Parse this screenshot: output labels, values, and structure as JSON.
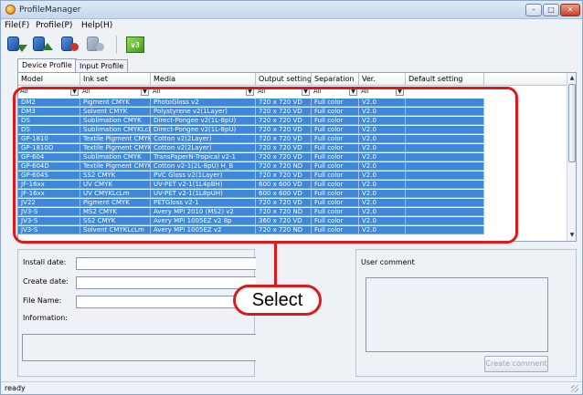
{
  "window": {
    "title": "ProfileManager"
  },
  "menu": [
    "File(F)",
    "Profile(P)",
    "Help(H)"
  ],
  "toolbar": [
    {
      "icon": "import-profile-icon"
    },
    {
      "icon": "export-profile-icon"
    },
    {
      "icon": "install-profile-icon"
    },
    {
      "icon": "delete-profile-icon"
    },
    {
      "icon": "v3-icon",
      "text": "v3"
    }
  ],
  "tabs": [
    "Device Profile",
    "Input Profile"
  ],
  "table": {
    "columns": [
      "Model",
      "Ink set",
      "Media",
      "Output setting",
      "Separation",
      "Ver.",
      "Default setting"
    ],
    "filter_value": "All",
    "rows": [
      [
        "DM2",
        "Pigment CMYK",
        "PhotoGloss v2",
        "720 x 720 VD",
        "Full color",
        "V2.0"
      ],
      [
        "DM3",
        "Solvent CMYK",
        "Polystyrene v2(1Layer)",
        "720 x 720 VD",
        "Full color",
        "V2.0"
      ],
      [
        "DS",
        "Sublimation CMYK",
        "Direct-Pongee v2(1L-8pU)",
        "720 x 720 VD",
        "Full color",
        "V2.0"
      ],
      [
        "DS",
        "Sublimation CMYKLcL...",
        "Direct-Pongee v2(1L-8pU)",
        "720 x 720 VD",
        "Full color",
        "V2.0"
      ],
      [
        "GP-1810",
        "Textile Pigment CMYK",
        "Cotton v2(2Layer)",
        "720 x 720 VD",
        "Full color",
        "V2.0"
      ],
      [
        "GP-1810D",
        "Textile Pigment CMYK",
        "Cotton v2(2Layer)",
        "720 x 720 VD",
        "Full color",
        "V2.0"
      ],
      [
        "GP-604",
        "Sublimation CMYK",
        "TransPaperN-Tropical v2-1",
        "720 x 720 VD",
        "Full color",
        "V2.0"
      ],
      [
        "GP-604D",
        "Textile Pigment CMYK",
        "Cotton v2-1(2L-8pU) H_B",
        "720 x 720 ND",
        "Full color",
        "V2.0"
      ],
      [
        "GP-604S",
        "SS2 CMYK",
        "PVC Gloss v2(1Layer)",
        "720 x 720 VD",
        "Full color",
        "V2.0"
      ],
      [
        "JF-16xx",
        "UV CMYK",
        "UV-PET v2-1(1L4pBH)",
        "600 x 600 VD",
        "Full color",
        "V2.0"
      ],
      [
        "JF-16xx",
        "UV CMYKLcLm",
        "UV-PET v2-1(1L8pUH)",
        "600 x 600 VD",
        "Full color",
        "V2.0"
      ],
      [
        "JV22",
        "Pigment CMYK",
        "PETGloss v2-1",
        "720 x 720 VD",
        "Full color",
        "V2.0"
      ],
      [
        "JV3-S",
        "MS2 CMYK",
        "Avery MPI 2010 (MS2) v2",
        "720 x 720 ND",
        "Full color",
        "V2.0"
      ],
      [
        "JV3-S",
        "SS2 CMYK",
        "Avery MPI 1005EZ v2 8p",
        "360 x 720 VD",
        "Full color",
        "V2.0"
      ],
      [
        "JV3-S",
        "Solvent CMYKLcLm",
        "Avery MPI 1005EZ v2",
        "720 x 720 ND",
        "Full color",
        "V2.0"
      ]
    ]
  },
  "info_panel": {
    "install_date_label": "Install date:",
    "create_date_label": "Create date:",
    "file_name_label": "File Name:",
    "information_label": "Information:"
  },
  "comment_panel": {
    "label": "User comment",
    "button": "Create comment"
  },
  "callout": {
    "text": "Select",
    "color": "#e0181a"
  },
  "status": {
    "text": "ready"
  },
  "colors": {
    "selection": "#3f87d8",
    "highlight": "#e0181a"
  }
}
